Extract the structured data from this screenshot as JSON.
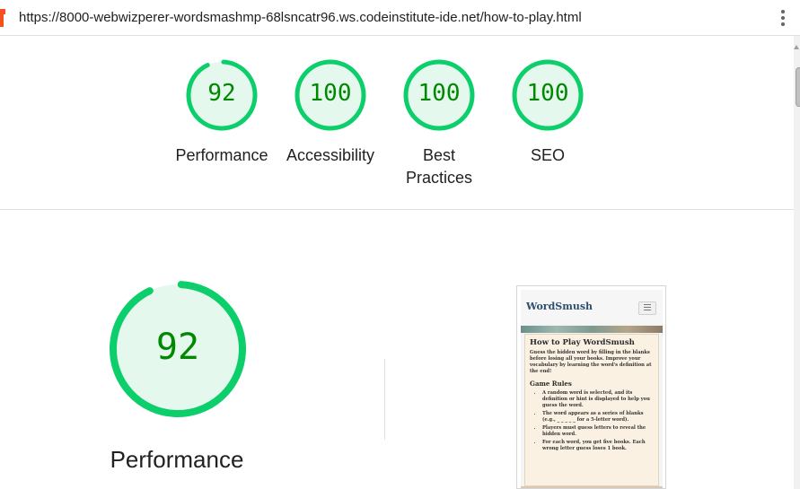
{
  "browser": {
    "url": "https://8000-webwizperer-wordsmashmp-68lsncatr96.ws.codeinstitute-ide.net/how-to-play.html"
  },
  "scores": [
    {
      "value": "92",
      "label": "Performance",
      "score": 92
    },
    {
      "value": "100",
      "label": "Accessibility",
      "score": 100
    },
    {
      "value": "100",
      "label": "Best Practices",
      "label_lines": [
        "Best",
        "Practices"
      ],
      "score": 100
    },
    {
      "value": "100",
      "label": "SEO",
      "score": 100
    }
  ],
  "main_score": {
    "value": "92",
    "label": "Performance",
    "score": 92
  },
  "colors": {
    "pass": "#0cce6b",
    "pass_bg": "#e5f8ed",
    "pass_text": "#008800"
  },
  "screenshot": {
    "brand": "WordSmush",
    "title": "How to Play WordSmush",
    "intro": "Guess the hidden word by filling in the blanks before losing all your books. Improve your vocabulary by learning the word's definition at the end!",
    "rules_heading": "Game Rules",
    "rules": [
      "A random word is selected, and its definition or hint is displayed to help you guess the word.",
      "The word appears as a series of blanks (e.g., _ _ _ _ _ for a 5-letter word).",
      "Players must guess letters to reveal the hidden word.",
      "For each word, you get five books. Each wrong letter guess loses 1 book."
    ]
  }
}
